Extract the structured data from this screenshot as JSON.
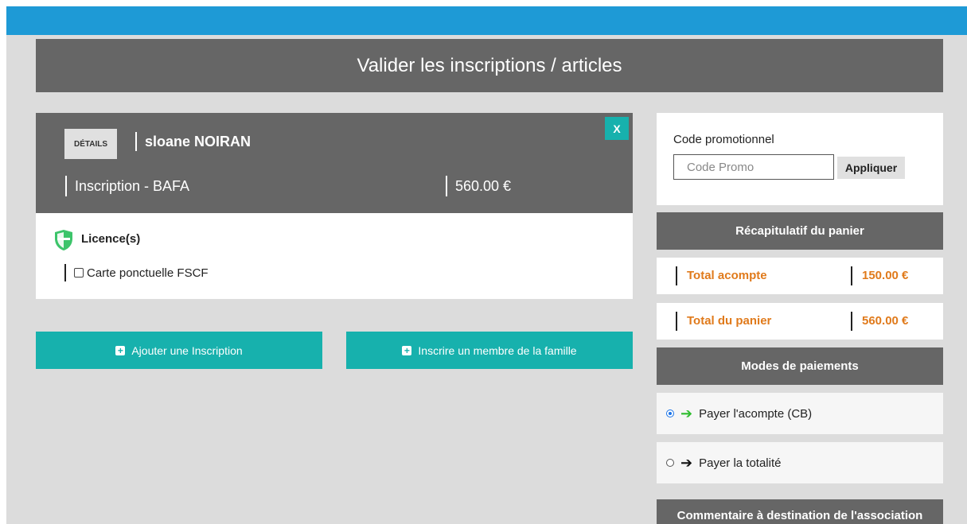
{
  "page": {
    "title": "Valider les inscriptions / articles"
  },
  "cart_item": {
    "details_label": "DÉTAILS",
    "member_name": "sloane NOIRAN",
    "remove_label": "X",
    "label": "Inscription - BAFA",
    "price": "560.00 €",
    "licences_title": "Licence(s)",
    "licence_option": "Carte ponctuelle FSCF"
  },
  "actions": {
    "add_registration": "Ajouter une Inscription",
    "add_family_member": "Inscrire un membre de la famille"
  },
  "promo": {
    "label": "Code promotionnel",
    "placeholder": "Code Promo",
    "apply_label": "Appliquer"
  },
  "summary": {
    "title": "Récapitulatif du panier",
    "deposit_label": "Total acompte",
    "deposit_value": "150.00 €",
    "cart_total_label": "Total du panier",
    "cart_total_value": "560.00 €"
  },
  "payment": {
    "title": "Modes de paiements",
    "options": [
      {
        "label": "Payer l'acompte (CB)",
        "selected": true
      },
      {
        "label": "Payer la totalité",
        "selected": false
      }
    ]
  },
  "comment": {
    "title": "Commentaire à destination de l'association"
  },
  "colors": {
    "topbar": "#1e9ad6",
    "header_gray": "#666666",
    "teal": "#17b1ad",
    "orange": "#e07a1b",
    "green": "#2ebd2e"
  }
}
